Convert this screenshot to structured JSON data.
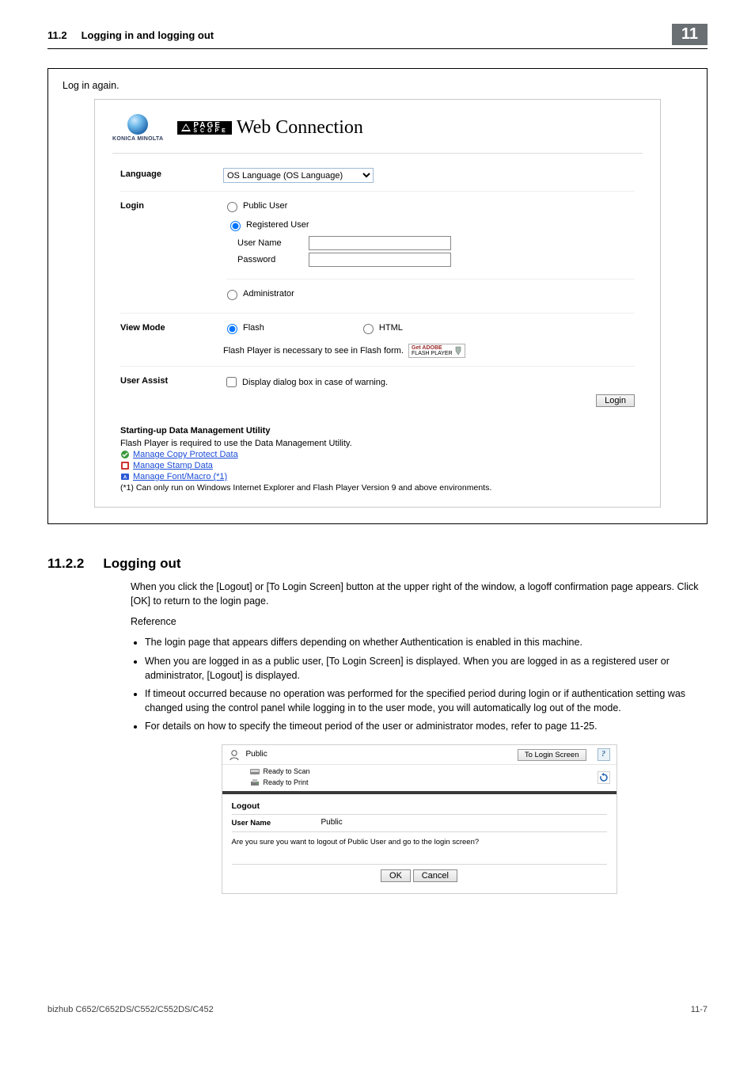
{
  "header": {
    "section": "11.2",
    "title": "Logging in and logging out",
    "chapter": "11"
  },
  "loginAgain": "Log in again.",
  "brand": {
    "konicaMinolta": "KONICA MINOLTA",
    "page": "PAGE",
    "scope": "SCOPE",
    "webConnection": "Web Connection"
  },
  "form": {
    "languageLabel": "Language",
    "languageSelected": "OS Language (OS Language)",
    "loginLabel": "Login",
    "publicUser": "Public User",
    "registeredUser": "Registered User",
    "userName": "User Name",
    "password": "Password",
    "administrator": "Administrator",
    "viewModeLabel": "View Mode",
    "flash": "Flash",
    "html": "HTML",
    "flashNote": "Flash Player is necessary to see in Flash form.",
    "adobeGet": "Get ADOBE",
    "adobeFP": "FLASH PLAYER",
    "userAssistLabel": "User Assist",
    "userAssistCheck": "Display dialog box in case of warning.",
    "loginBtn": "Login"
  },
  "startup": {
    "title": "Starting-up Data Management Utility",
    "note": "Flash Player is required to use the Data Management Utility.",
    "link1": "Manage Copy Protect Data",
    "link2": "Manage Stamp Data",
    "link3": "Manage Font/Macro (*1)",
    "foot": "(*1) Can only run on Windows Internet Explorer and Flash Player Version 9 and above environments."
  },
  "section": {
    "num": "11.2.2",
    "title": "Logging out",
    "intro": "When you click the [Logout] or [To Login Screen] button at the upper right of the window, a logoff confirmation page appears. Click [OK] to return to the login page.",
    "reference": "Reference",
    "b1": "The login page that appears differs depending on whether Authentication is enabled in this machine.",
    "b2": "When you are logged in as a public user, [To Login Screen] is displayed. When you are logged in as a registered user or administrator, [Logout] is displayed.",
    "b3": "If timeout occurred because no operation was performed for the specified period during login or if authentication setting was changed using the control panel while logging in to the user mode, you will automatically log out of the mode.",
    "b4": "For details on how to specify the timeout period of the user or administrator modes, refer to page 11-25."
  },
  "logoutPanel": {
    "public": "Public",
    "toLogin": "To Login Screen",
    "readyScan": "Ready to Scan",
    "readyPrint": "Ready to Print",
    "logout": "Logout",
    "userNameLabel": "User Name",
    "userNameVal": "Public",
    "confirm": "Are you sure you want to logout of Public User and go to the login screen?",
    "ok": "OK",
    "cancel": "Cancel"
  },
  "footer": {
    "left": "bizhub C652/C652DS/C552/C552DS/C452",
    "right": "11-7"
  }
}
